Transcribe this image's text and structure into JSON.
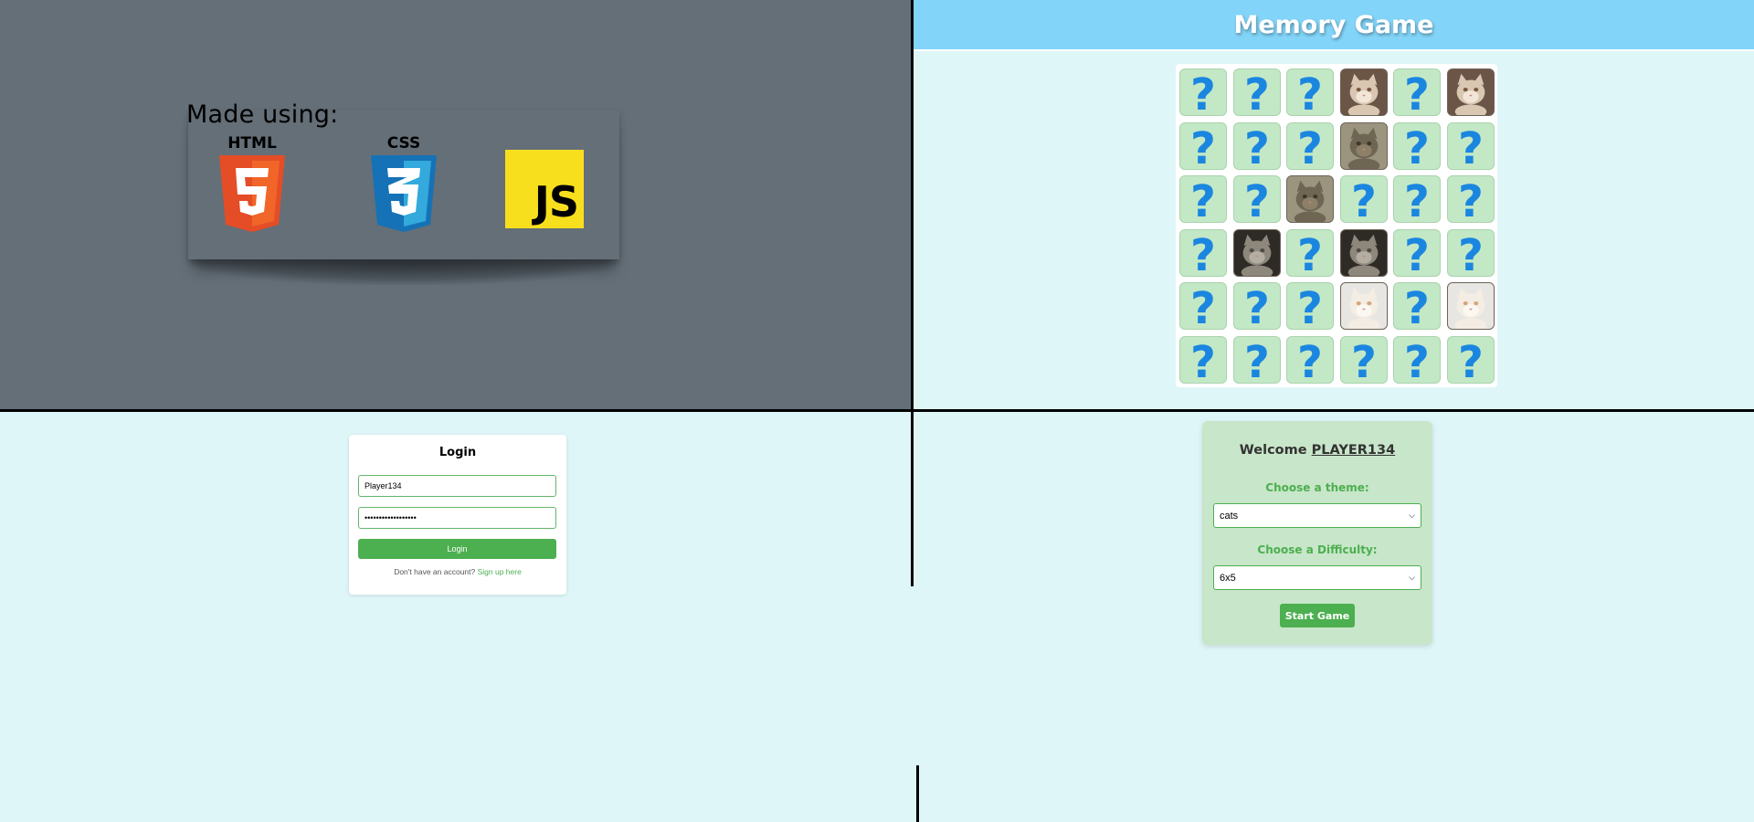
{
  "tech": {
    "title": "Made using:",
    "logos": [
      {
        "name": "HTML",
        "icon": "html5-icon",
        "color": "#e44d26"
      },
      {
        "name": "CSS",
        "icon": "css3-icon",
        "color": "#2965f1"
      },
      {
        "name": "JS",
        "icon": "javascript-icon",
        "color": "#f7df1e"
      }
    ]
  },
  "game": {
    "title": "Memory Game",
    "grid": [
      [
        "hidden",
        "hidden",
        "hidden",
        "cat-grumpy",
        "hidden",
        "cat-grumpy"
      ],
      [
        "hidden",
        "hidden",
        "hidden",
        "cat-wine",
        "hidden",
        "hidden"
      ],
      [
        "hidden",
        "hidden",
        "cat-wine",
        "hidden",
        "hidden",
        "hidden"
      ],
      [
        "hidden",
        "cat-tabby",
        "hidden",
        "cat-tabby",
        "hidden",
        "hidden"
      ],
      [
        "hidden",
        "hidden",
        "hidden",
        "cat-kitten",
        "hidden",
        "cat-kitten"
      ],
      [
        "hidden",
        "hidden",
        "hidden",
        "hidden",
        "hidden",
        "hidden"
      ]
    ],
    "colors": {
      "header": "#82d4f8",
      "card": "#c3e8c6",
      "question": "#1a86e0"
    }
  },
  "login": {
    "title": "Login",
    "username": "Player134",
    "password": "••••••••••••••••••",
    "button": "Login",
    "signup_prompt": "Don't have an account?",
    "signup_link": "Sign up here"
  },
  "menu": {
    "welcome": "Welcome",
    "player": "PLAYER134",
    "theme_label": "Choose a theme:",
    "theme_value": "cats",
    "difficulty_label": "Choose a Difficulty:",
    "difficulty_value": "6x5",
    "start_button": "Start Game"
  }
}
